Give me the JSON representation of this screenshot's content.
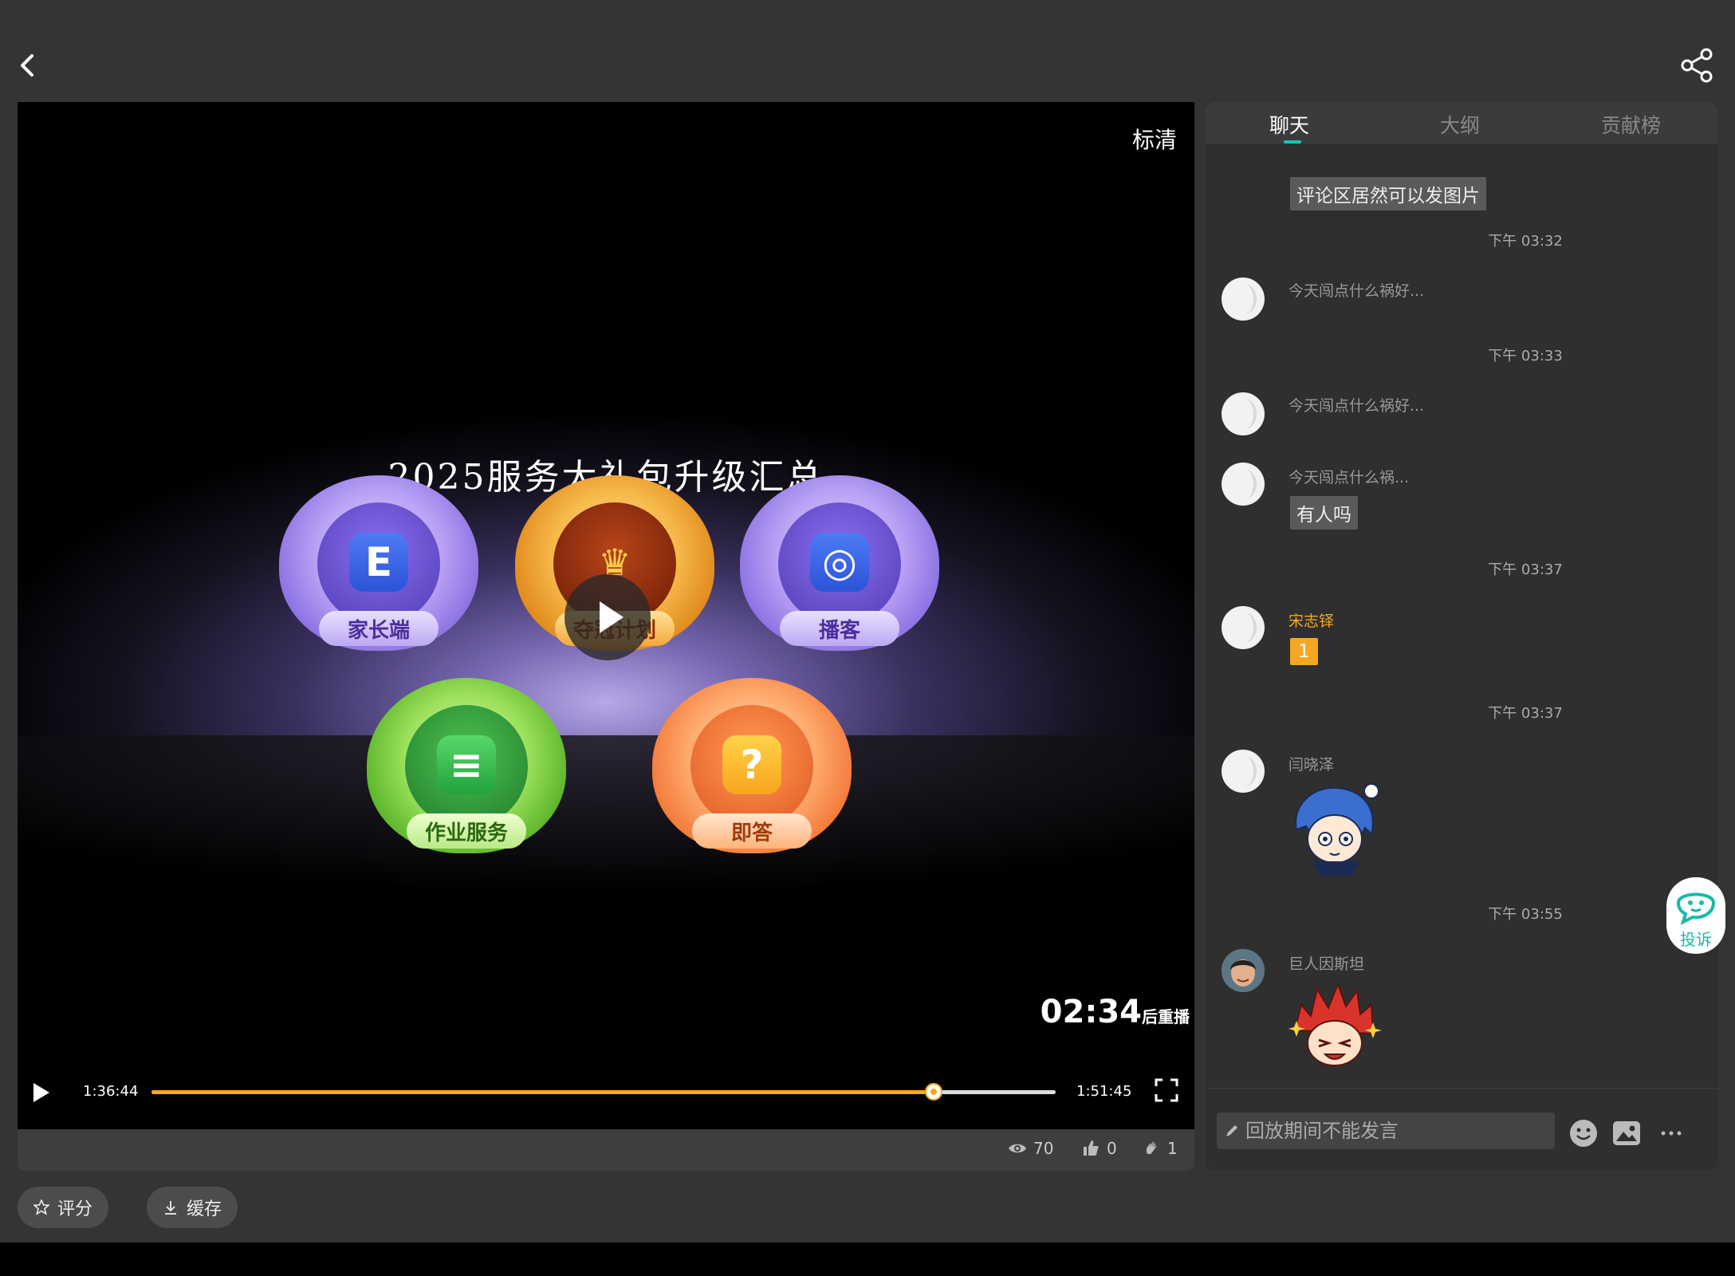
{
  "header": {
    "back_icon": "chevron-left-icon",
    "share_icon": "share-icon"
  },
  "player": {
    "quality": "标清",
    "slide_title": "2025服务大礼包升级汇总",
    "badges": [
      {
        "label": "家长端",
        "mini": "家长端",
        "glyph": "E",
        "color": "purple"
      },
      {
        "label": "夺冠计划",
        "glyph": "♛",
        "color": "gold"
      },
      {
        "label": "播客",
        "glyph": "◎",
        "color": "purple"
      },
      {
        "label": "作业服务",
        "glyph": "≡",
        "color": "green"
      },
      {
        "label": "即答",
        "glyph": "?",
        "color": "orange"
      }
    ],
    "replay_time": "02:34",
    "replay_suffix": "后重播",
    "current_time": "1:36:44",
    "total_time": "1:51:45",
    "progress": 0.865,
    "accent": "#f5a623"
  },
  "stats": {
    "views": "70",
    "likes": "0",
    "claps": "1"
  },
  "actions": {
    "rate": "评分",
    "cache": "缓存"
  },
  "tabs": [
    {
      "label": "聊天",
      "active": true
    },
    {
      "label": "大纲",
      "active": false
    },
    {
      "label": "贡献榜",
      "active": false
    }
  ],
  "chat": {
    "top_bubble": "评论区居然可以发图片",
    "ts1": "下午 03:32",
    "msg1": "今天闯点什么祸好...",
    "ts2": "下午 03:33",
    "msg2": "今天闯点什么祸好...",
    "msg3_name": "今天闯点什么祸...",
    "msg3_text": "有人吗",
    "ts3": "下午 03:37",
    "msg4_name": "宋志铎",
    "msg4_text": "1",
    "ts4": "下午 03:37",
    "msg5_name": "闫晓泽",
    "ts5": "下午 03:55",
    "msg6_name": "巨人因斯坦"
  },
  "composer": {
    "placeholder": "回放期间不能发言",
    "emoji_icon": "emoji-icon",
    "image_icon": "image-icon",
    "more_icon": "more-icon"
  },
  "float": {
    "complain": "投诉"
  }
}
